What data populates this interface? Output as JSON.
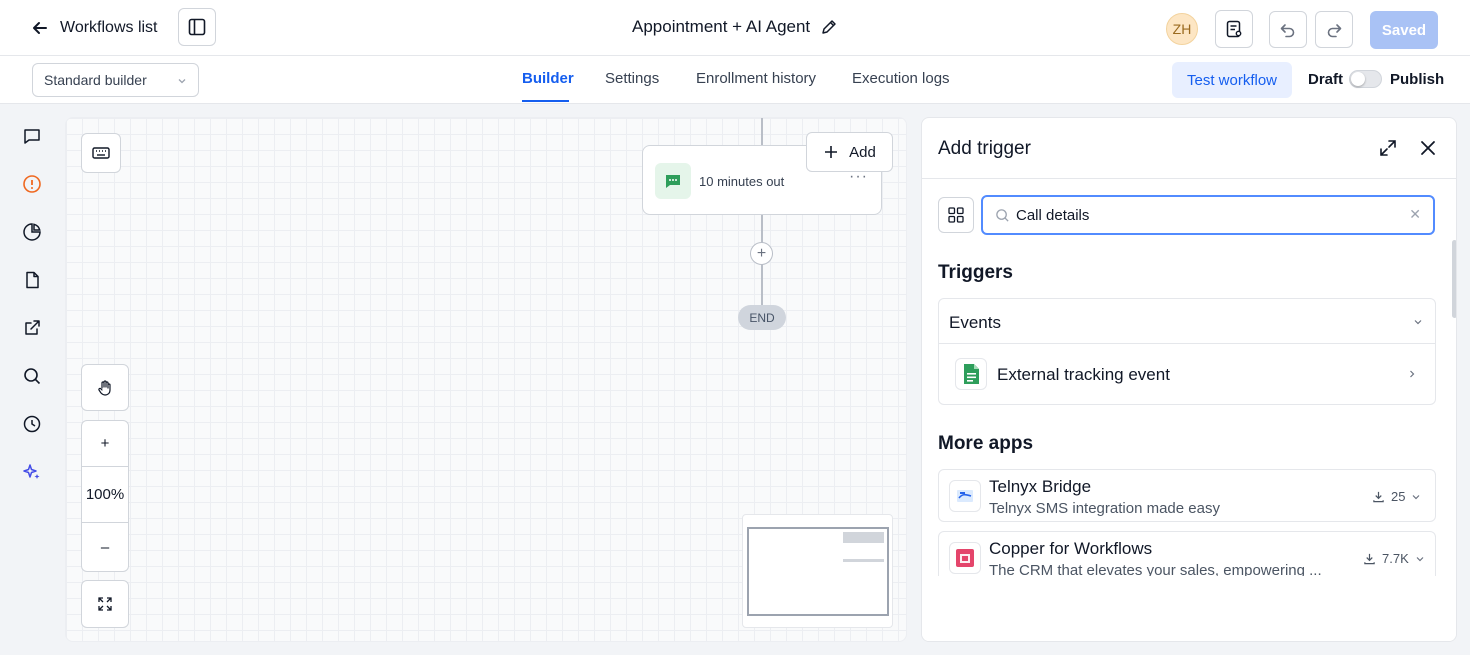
{
  "header": {
    "back_label": "Workflows list",
    "workflow_title": "Appointment + AI Agent",
    "avatar_initials": "ZH",
    "saved_label": "Saved"
  },
  "subheader": {
    "builder_mode": "Standard builder",
    "tabs": [
      {
        "label": "Builder",
        "active": true
      },
      {
        "label": "Settings",
        "active": false
      },
      {
        "label": "Enrollment history",
        "active": false
      },
      {
        "label": "Execution logs",
        "active": false
      }
    ],
    "test_workflow_label": "Test workflow",
    "draft_label": "Draft",
    "publish_label": "Publish",
    "publish_toggle_on": false
  },
  "left_rail": {
    "icons": [
      "chat-icon",
      "alert-circle-icon",
      "pie-chart-icon",
      "document-icon",
      "external-link-icon",
      "search-icon",
      "history-icon",
      "sparkles-icon"
    ]
  },
  "canvas": {
    "node_label": "10 minutes out",
    "add_label": "Add",
    "end_label": "END",
    "zoom_level": "100%",
    "plus_symbol": "+",
    "minus_symbol": "–"
  },
  "panel": {
    "title": "Add trigger",
    "search_value": "Call details",
    "triggers_heading": "Triggers",
    "events_label": "Events",
    "event_item": "External tracking event",
    "more_apps_heading": "More apps",
    "apps": [
      {
        "name": "Telnyx Bridge",
        "description": "Telnyx SMS integration made easy",
        "installs": "25"
      },
      {
        "name": "Copper for Workflows",
        "description": "The CRM that elevates your sales, empowering ...",
        "installs": "7.7K"
      }
    ]
  },
  "colors": {
    "accent": "#155eef",
    "saved_button": "#a9c2f5",
    "node_icon_green": "#2e9e5b"
  }
}
